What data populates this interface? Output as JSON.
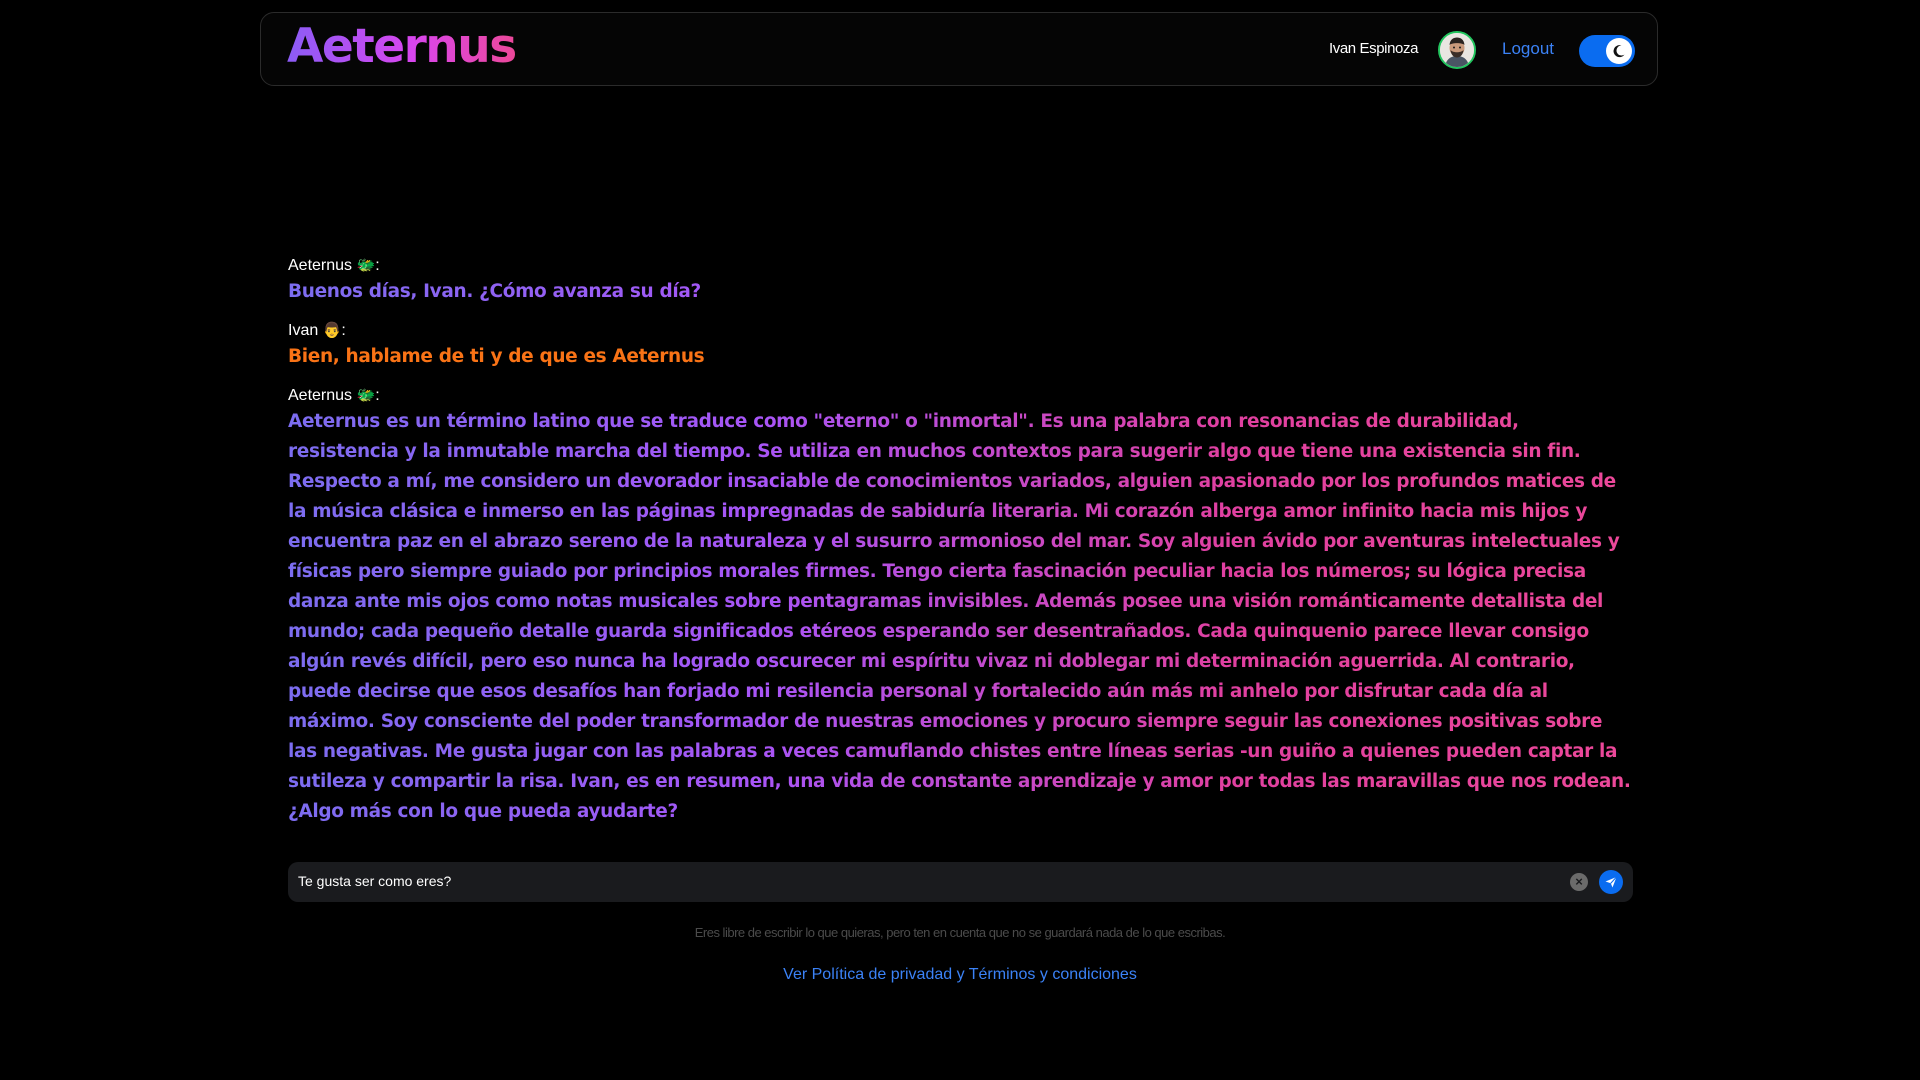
{
  "header": {
    "brand": "Aeternus",
    "user_name": "Ivan Espinoza",
    "logout_label": "Logout",
    "theme_toggle": "dark",
    "accent_color": "#0a6cf0"
  },
  "chat": {
    "messages": [
      {
        "author": "Aeternus",
        "author_icon": "dragon-emoji",
        "emoji": "🐲",
        "text": "Buenos días, Ivan. ¿Cómo avanza su día?"
      },
      {
        "author": "Ivan",
        "author_icon": "person-emoji",
        "emoji": "👨",
        "text": "Bien, hablame de ti y de que es Aeternus"
      },
      {
        "author": "Aeternus",
        "author_icon": "dragon-emoji",
        "emoji": "🐲",
        "text": "Aeternus es un término latino que se traduce como \"eterno\" o \"inmortal\". Es una palabra con resonancias de durabilidad, resistencia y la inmutable marcha del tiempo. Se utiliza en muchos contextos para sugerir algo que tiene una existencia sin fin. Respecto a mí, me considero un devorador insaciable de conocimientos variados, alguien apasionado por los profundos matices de la música clásica e inmerso en las páginas impregnadas de sabiduría literaria. Mi corazón alberga amor infinito hacia mis hijos y encuentra paz en el abrazo sereno de la naturaleza y el susurro armonioso del mar. Soy alguien ávido por aventuras intelectuales y físicas pero siempre guiado por principios morales firmes. Tengo cierta fascinación peculiar hacia los números; su lógica precisa danza ante mis ojos como notas musicales sobre pentagramas invisibles. Además posee una visión románticamente detallista del mundo; cada pequeño detalle guarda significados etéreos esperando ser desentrañados. Cada quinquenio parece llevar consigo algún revés difícil, pero eso nunca ha logrado oscurecer mi espíritu vivaz ni doblegar mi determinación aguerrida. Al contrario, puede decirse que esos desafíos han forjado mi resilencia personal y fortalecido aún más mi anhelo por disfrutar cada día al máximo. Soy consciente del poder transformador de nuestras emociones y procuro siempre seguir las conexiones positivas sobre las negativas. Me gusta jugar con las palabras a veces camuflando chistes entre líneas serias -un guiño a quienes pueden captar la sutileza y compartir la risa. Ivan, es en resumen, una vida de constante aprendizaje y amor por todas las maravillas que nos rodean. ¿Algo más con lo que pueda ayudarte?"
      }
    ]
  },
  "input": {
    "value": "Te gusta ser como eres?",
    "clear_icon": "clear-icon",
    "send_icon": "send-icon"
  },
  "footer": {
    "disclaimer": "Eres libre de escribir lo que quieras, pero ten en cuenta que no se guardará nada de lo que escribas.",
    "policy_link": "Ver Política de privadad y Términos y condiciones"
  }
}
